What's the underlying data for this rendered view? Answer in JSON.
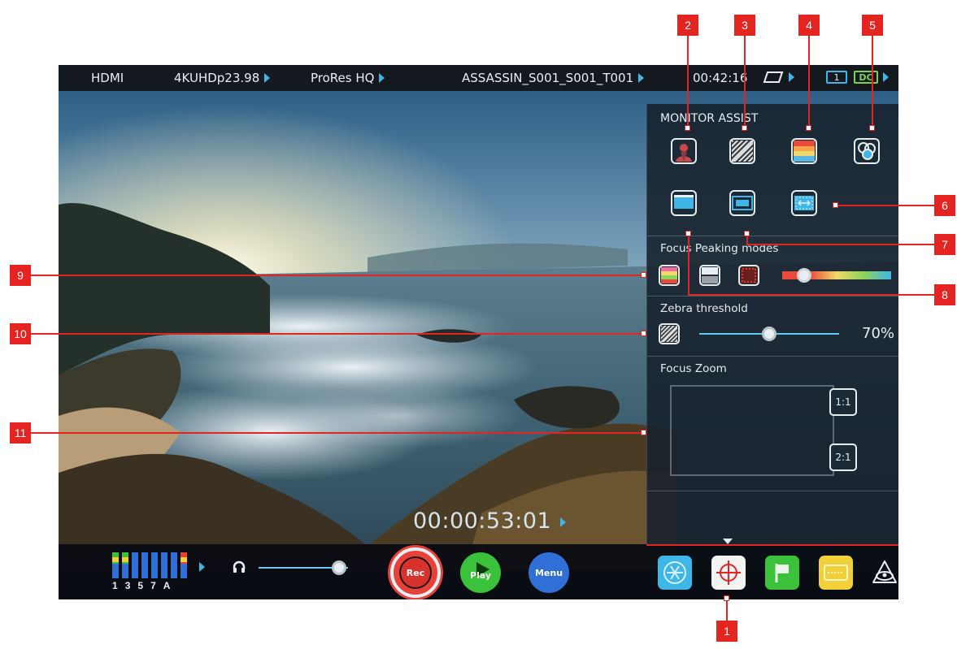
{
  "topbar": {
    "input": "HDMI",
    "format": "4KUHDp23.98",
    "codec": "ProRes HQ",
    "filename": "ASSASSIN_S001_S001_T001",
    "remaining": "00:42:16",
    "battery_slot": "1",
    "dc_label": "DC"
  },
  "panel": {
    "title": "MONITOR ASSIST",
    "focus_peaking_title": "Focus Peaking modes",
    "zebra_title": "Zebra threshold",
    "zebra_value": "70%",
    "zebra_level": 0.5,
    "peaking_level": 0.2,
    "focus_zoom_title": "Focus Zoom",
    "zoom_1to1": "1:1",
    "zoom_2to1": "2:1"
  },
  "timecode": "00:00:53:01",
  "audio": {
    "channel_labels": [
      "1",
      "3",
      "5",
      "7",
      "A"
    ],
    "headphone_volume": 0.9
  },
  "transport": {
    "rec_label": "Rec",
    "play_label": "Play",
    "menu_label": "Menu"
  },
  "callouts": [
    "1",
    "2",
    "3",
    "4",
    "5",
    "6",
    "7",
    "8",
    "9",
    "10",
    "11"
  ],
  "colors": {
    "accent_blue": "#3fb6e8",
    "rec_red": "#e8413a",
    "play_green": "#3cc23a",
    "menu_blue": "#2f6fd6",
    "callout_red": "#e42421"
  },
  "icons": {
    "input_settings": "input-settings-icon",
    "monitor_assist": "crosshair-icon",
    "tag": "flag-icon",
    "playlist": "film-icon",
    "brand": "atomos-logo-icon"
  }
}
